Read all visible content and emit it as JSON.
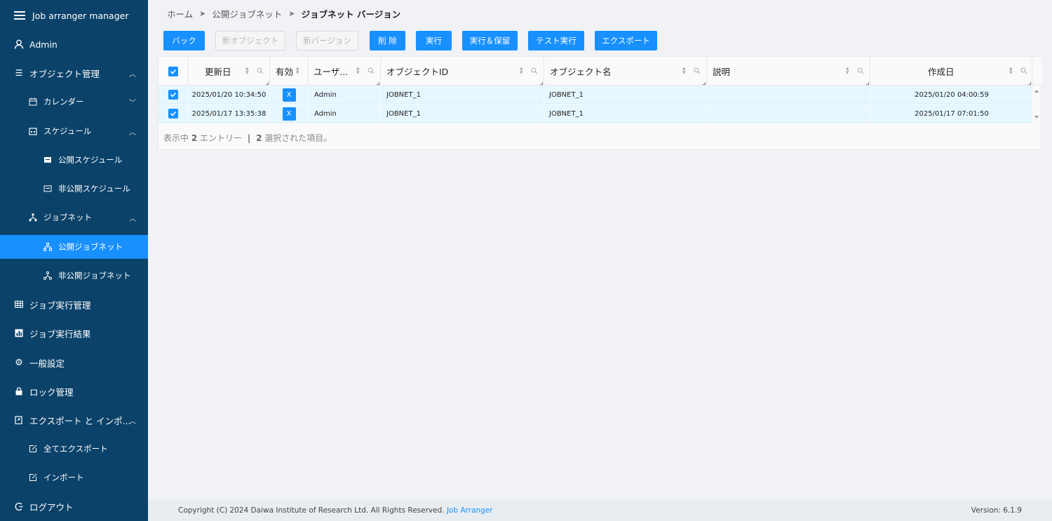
{
  "app": {
    "title": "Job arranger manager",
    "user": "Admin"
  },
  "sidebar": {
    "object_mgmt": "オブジェクト管理",
    "calendar": "カレンダー",
    "schedule": "スケジュール",
    "public_schedule": "公開スケジュール",
    "private_schedule": "非公開スケジュール",
    "jobnet": "ジョブネット",
    "public_jobnet": "公開ジョブネット",
    "private_jobnet": "非公開ジョブネット",
    "job_exec_mgmt": "ジョブ実行管理",
    "job_exec_result": "ジョブ実行結果",
    "general_settings": "一般設定",
    "lock_mgmt": "ロック管理",
    "export_import": "エクスポート と インポ...",
    "export_all": "全てエクスポート",
    "import": "インポート",
    "logout": "ログアウト"
  },
  "breadcrumb": {
    "home": "ホーム",
    "public_jobnet": "公開ジョブネット",
    "current": "ジョブネット バージョン"
  },
  "toolbar": {
    "back": "バック",
    "new_object": "新オブジェクト",
    "new_version": "新バージョン",
    "delete": "削 除",
    "run": "実行",
    "run_hold": "実行＆保留",
    "test_run": "テスト実行",
    "export": "エクスポート"
  },
  "table": {
    "headers": {
      "updated": "更新日",
      "valid": "有効",
      "user": "ユーザ...",
      "object_id": "オブジェクトID",
      "object_name": "オブジェクト名",
      "description": "説明",
      "created": "作成日"
    },
    "rows": [
      {
        "updated": "2025/01/20 10:34:50",
        "valid": "X",
        "user": "Admin",
        "object_id": "JOBNET_1",
        "object_name": "JOBNET_1",
        "description": "",
        "created": "2025/01/20 04:00:59"
      },
      {
        "updated": "2025/01/17 13:35:38",
        "valid": "X",
        "user": "Admin",
        "object_id": "JOBNET_1",
        "object_name": "JOBNET_1",
        "description": "",
        "created": "2025/01/17 07:01:50"
      }
    ],
    "status": {
      "prefix": "表示中",
      "count": "2",
      "entries": "エントリー",
      "divider": "|",
      "selected": "2",
      "selected_suffix": "選択された項目。"
    }
  },
  "footer": {
    "copyright": "Copyright (C) 2024 Daiwa Institute of Research Ltd. All Rights Reserved.",
    "link": "Job Arranger",
    "version": "Version: 6.1.9"
  },
  "colors": {
    "sidebar_bg": "#0b4269",
    "accent": "#1890ff",
    "row_selected": "#e6f7ff"
  }
}
